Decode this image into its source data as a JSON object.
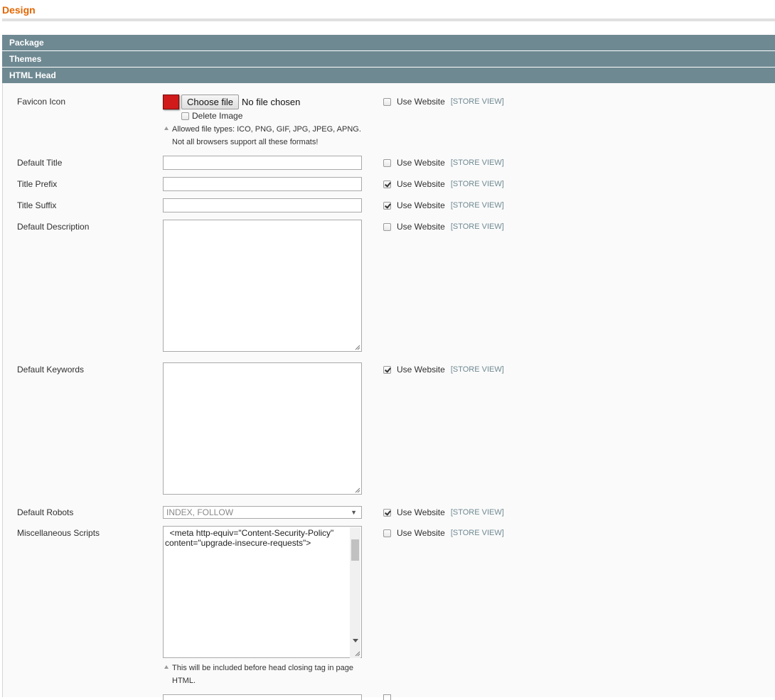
{
  "page": {
    "title": "Design"
  },
  "sections": {
    "package": "Package",
    "themes": "Themes",
    "html_head": "HTML Head"
  },
  "common": {
    "use_website": "Use Website",
    "scope": "[STORE VIEW]"
  },
  "favicon": {
    "label": "Favicon Icon",
    "choose_file": "Choose file",
    "file_status": "No file chosen",
    "delete_label": "Delete Image",
    "delete_checked": false,
    "note_line1": "Allowed file types: ICO, PNG, GIF, JPG, JPEG, APNG.",
    "note_line2": "Not all browsers support all these formats!",
    "use_website_checked": false
  },
  "fields": {
    "default_title": {
      "label": "Default Title",
      "value": "",
      "use_website_checked": false
    },
    "title_prefix": {
      "label": "Title Prefix",
      "value": "",
      "use_website_checked": true
    },
    "title_suffix": {
      "label": "Title Suffix",
      "value": "",
      "use_website_checked": true
    },
    "default_description": {
      "label": "Default Description",
      "value": "",
      "use_website_checked": false
    },
    "default_keywords": {
      "label": "Default Keywords",
      "value": "",
      "use_website_checked": true
    },
    "default_robots": {
      "label": "Default Robots",
      "value": "INDEX, FOLLOW",
      "use_website_checked": true
    },
    "misc_scripts": {
      "label": "Miscellaneous Scripts",
      "value": "  <meta http-equiv=\"Content-Security-Policy\"\ncontent=\"upgrade-insecure-requests\">",
      "note_line1": "This will be included before head closing tag in page",
      "note_line2": "HTML.",
      "use_website_checked": false
    }
  },
  "colors": {
    "accent": "#e26703",
    "section_header": "#6f8992"
  }
}
